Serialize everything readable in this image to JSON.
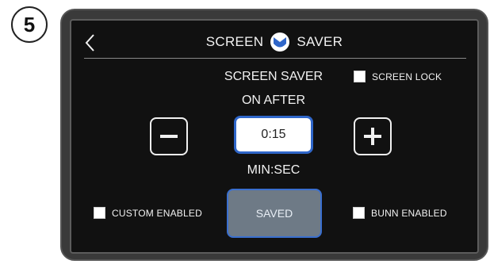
{
  "step_number": "5",
  "header": {
    "title_left": "SCREEN",
    "title_right": "SAVER"
  },
  "screen_saver": {
    "label_line1": "SCREEN SAVER",
    "label_line2": "ON AFTER",
    "value": "0:15",
    "unit_label": "MIN:SEC"
  },
  "options": {
    "screen_lock": "SCREEN LOCK",
    "custom_enabled": "CUSTOM ENABLED",
    "bunn_enabled": "BUNN ENABLED"
  },
  "saved_button_label": "SAVED",
  "colors": {
    "accent_blue": "#2f66c9",
    "saved_button_bg": "#6e7a86"
  },
  "icons": {
    "back": "chevron-left-icon",
    "logo": "bunn-shield-logo-icon",
    "decrement": "minus-icon",
    "increment": "plus-icon"
  }
}
